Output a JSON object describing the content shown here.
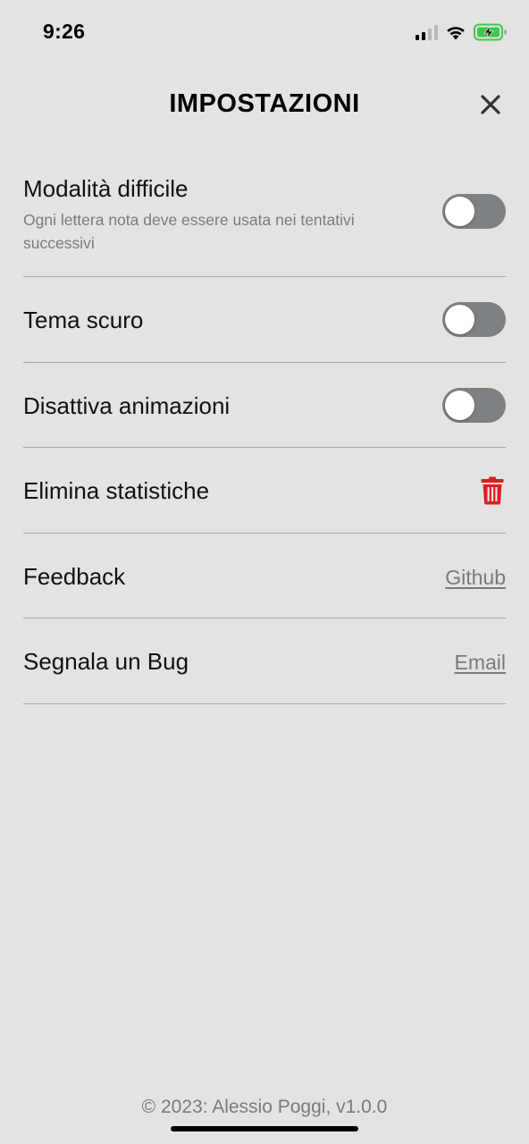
{
  "status_bar": {
    "time": "9:26",
    "icons": [
      "signal-icon",
      "wifi-icon",
      "battery-charging-icon"
    ],
    "battery_color": "#3ec84a"
  },
  "header": {
    "title": "IMPOSTAZIONI",
    "close_icon": "close-icon"
  },
  "settings": {
    "hard_mode": {
      "label": "Modalità difficile",
      "description": "Ogni lettera nota deve essere usata nei tentativi successivi",
      "enabled": false
    },
    "dark_theme": {
      "label": "Tema scuro",
      "enabled": false
    },
    "disable_animations": {
      "label": "Disattiva animazioni",
      "enabled": false
    },
    "delete_stats": {
      "label": "Elimina statistiche",
      "icon": "trash-icon",
      "icon_color": "#e01e1e"
    },
    "feedback": {
      "label": "Feedback",
      "link": "Github"
    },
    "report_bug": {
      "label": "Segnala un Bug",
      "link": "Email"
    }
  },
  "footer": {
    "text": "© 2023: Alessio Poggi, v1.0.0"
  },
  "colors": {
    "background": "#e3e3e1",
    "toggle_off": "#7e8183",
    "divider": "#a6a6a6",
    "muted_text": "#7a7a7a"
  }
}
